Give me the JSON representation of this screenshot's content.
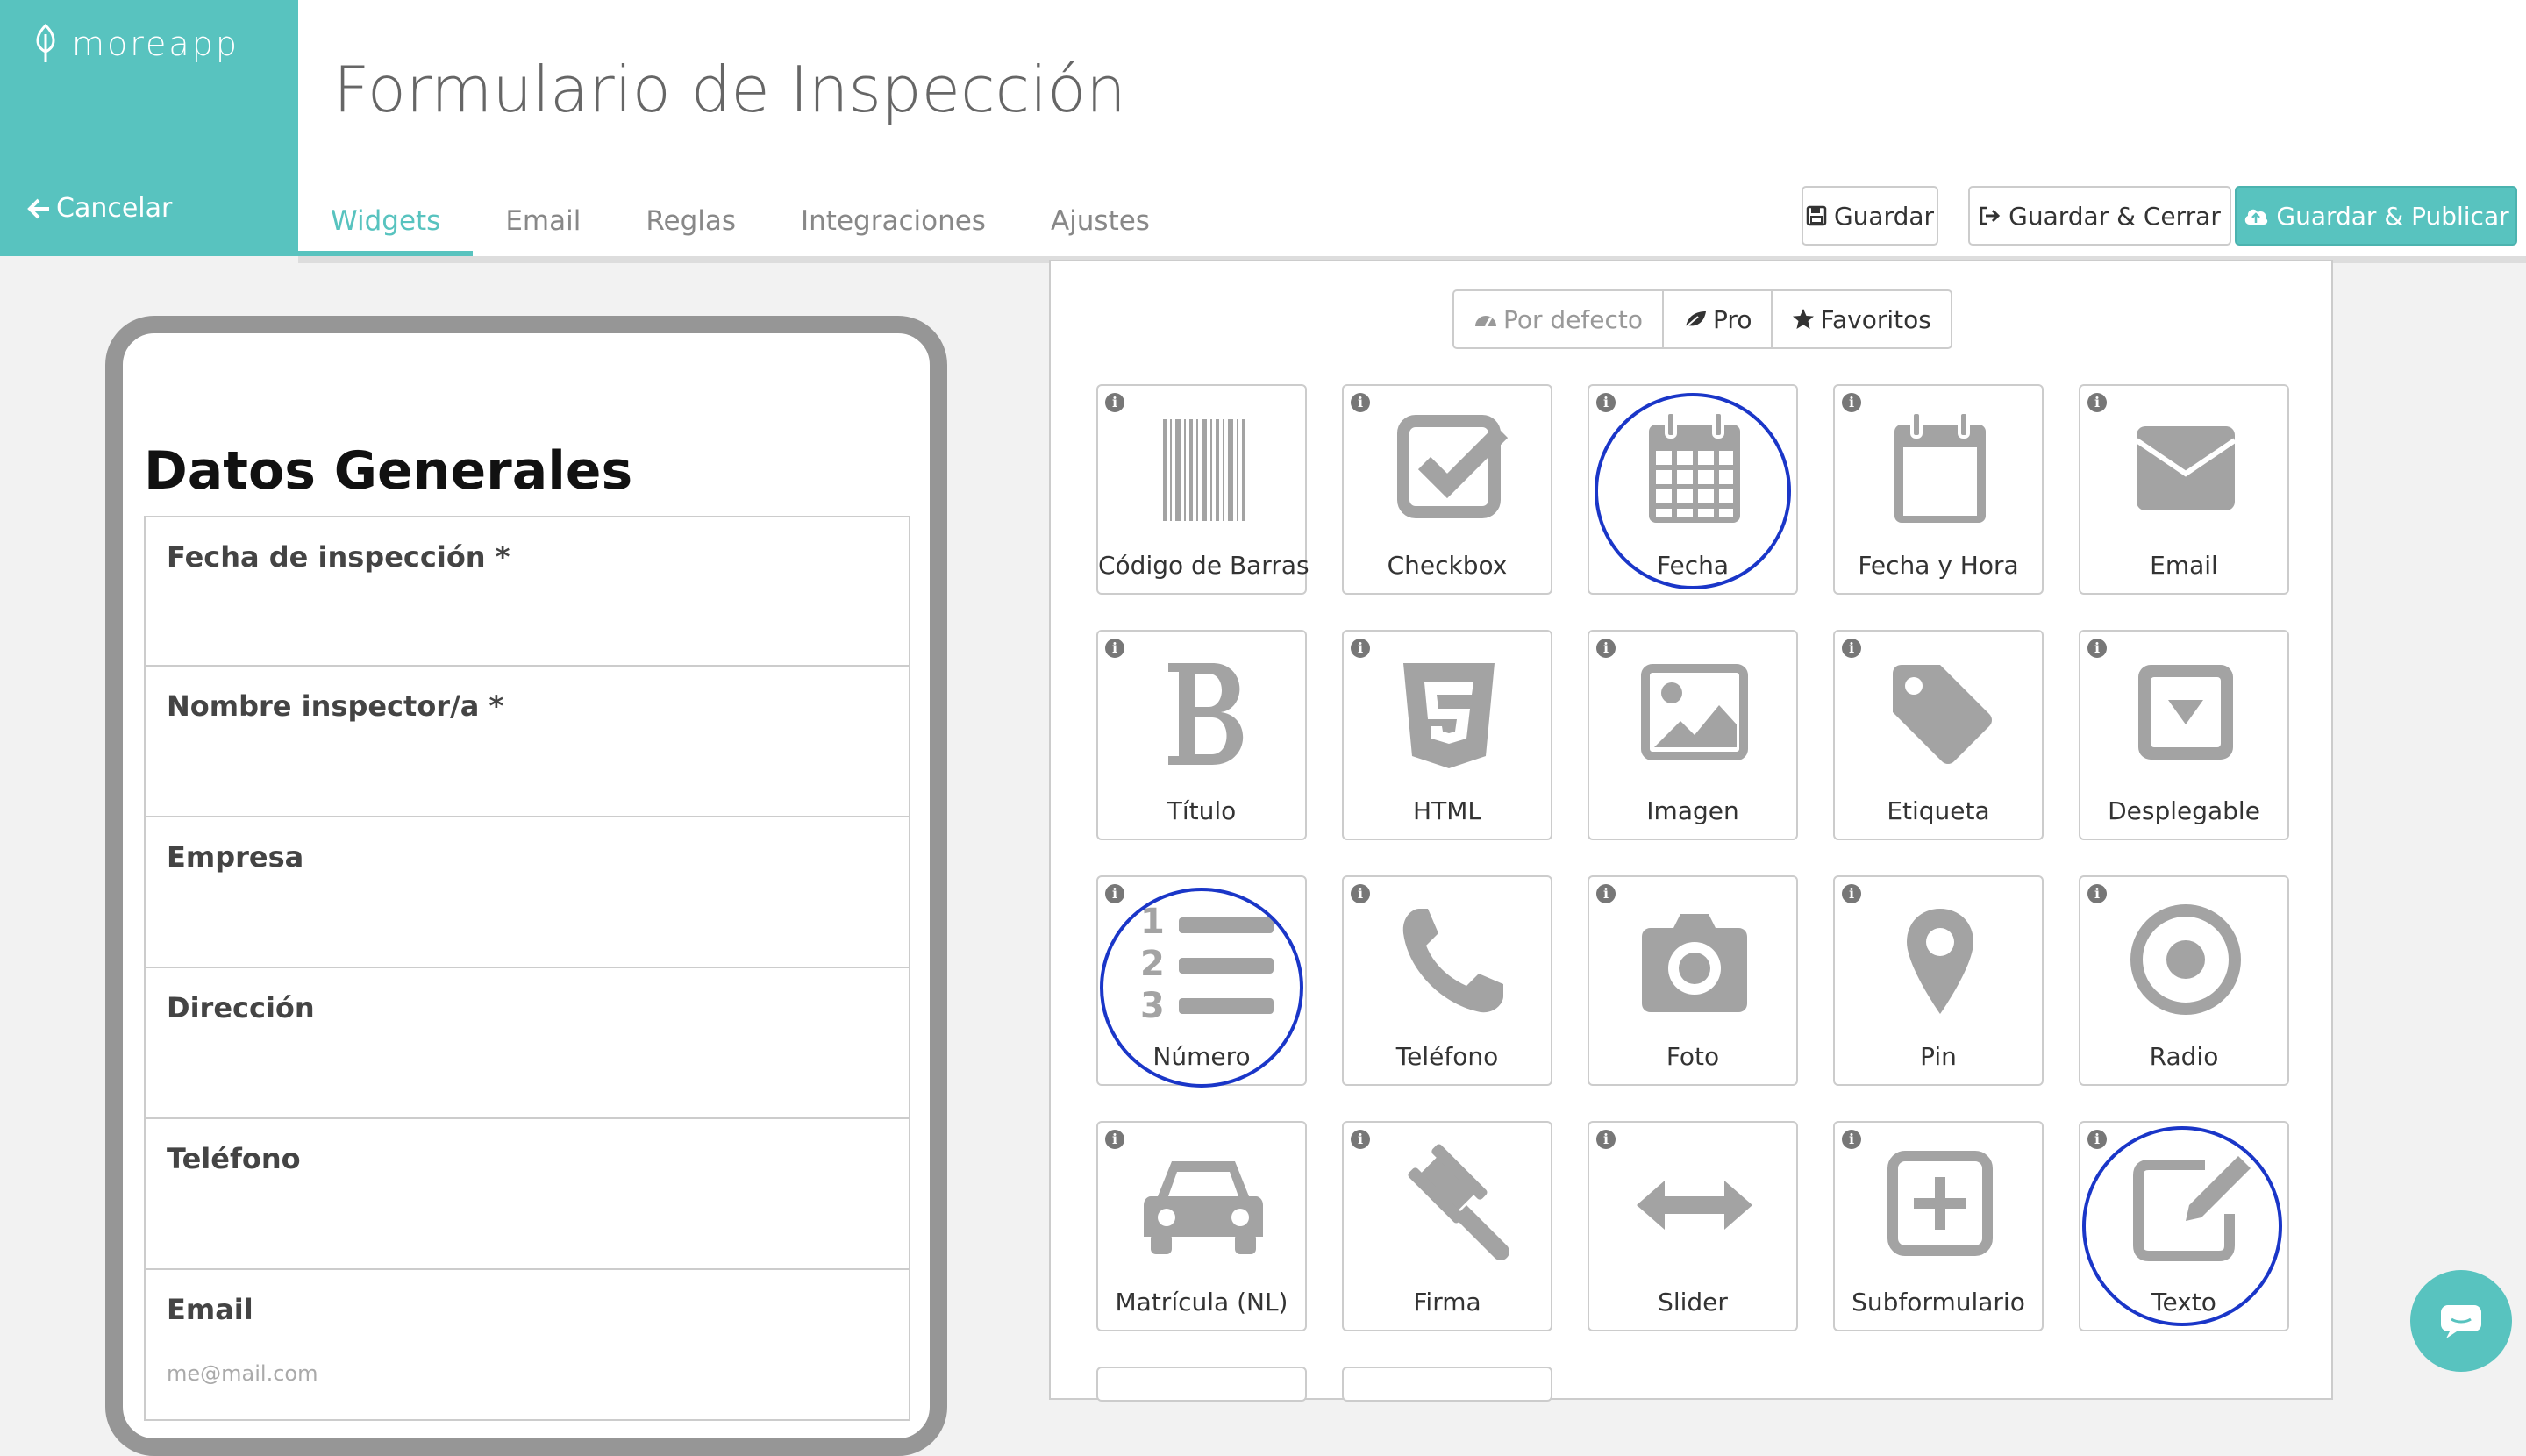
{
  "app": {
    "logo": "moreapp",
    "cancel": "Cancelar"
  },
  "header": {
    "title": "Formulario de Inspección",
    "tabs": [
      "Widgets",
      "Email",
      "Reglas",
      "Integraciones",
      "Ajustes"
    ],
    "active_tab": "Widgets",
    "buttons": {
      "save": "Guardar",
      "save_close": "Guardar & Cerrar",
      "save_publish": "Guardar & Publicar"
    }
  },
  "preview": {
    "section_title": "Datos Generales",
    "fields": [
      {
        "label": "Fecha de inspección *",
        "placeholder": ""
      },
      {
        "label": "Nombre inspector/a *",
        "placeholder": ""
      },
      {
        "label": "Empresa",
        "placeholder": ""
      },
      {
        "label": "Dirección",
        "placeholder": ""
      },
      {
        "label": "Teléfono",
        "placeholder": ""
      },
      {
        "label": "Email",
        "placeholder": "me@mail.com"
      }
    ]
  },
  "widget_panel": {
    "categories": [
      "Por defecto",
      "Pro",
      "Favoritos"
    ],
    "info_glyph": "i",
    "widgets": [
      {
        "label": "Código de Barras",
        "icon": "barcode-icon"
      },
      {
        "label": "Checkbox",
        "icon": "checkbox-icon"
      },
      {
        "label": "Fecha",
        "icon": "calendar-icon",
        "highlighted": true
      },
      {
        "label": "Fecha y Hora",
        "icon": "calendar-blank-icon"
      },
      {
        "label": "Email",
        "icon": "envelope-icon"
      },
      {
        "label": "Título",
        "icon": "bold-icon"
      },
      {
        "label": "HTML",
        "icon": "html5-icon"
      },
      {
        "label": "Imagen",
        "icon": "image-icon"
      },
      {
        "label": "Etiqueta",
        "icon": "tag-icon"
      },
      {
        "label": "Desplegable",
        "icon": "dropdown-icon"
      },
      {
        "label": "Número",
        "icon": "ordered-list-icon",
        "highlighted": true
      },
      {
        "label": "Teléfono",
        "icon": "phone-icon"
      },
      {
        "label": "Foto",
        "icon": "camera-icon"
      },
      {
        "label": "Pin",
        "icon": "map-pin-icon"
      },
      {
        "label": "Radio",
        "icon": "radio-icon"
      },
      {
        "label": "Matrícula (NL)",
        "icon": "car-icon"
      },
      {
        "label": "Firma",
        "icon": "gavel-icon"
      },
      {
        "label": "Slider",
        "icon": "arrows-h-icon"
      },
      {
        "label": "Subformulario",
        "icon": "plus-square-icon"
      },
      {
        "label": "Texto",
        "icon": "edit-icon",
        "highlighted": true
      }
    ]
  },
  "colors": {
    "brand": "#58c3bf",
    "highlight_ring": "#1a36c8",
    "icon_gray": "#a3a3a3"
  }
}
